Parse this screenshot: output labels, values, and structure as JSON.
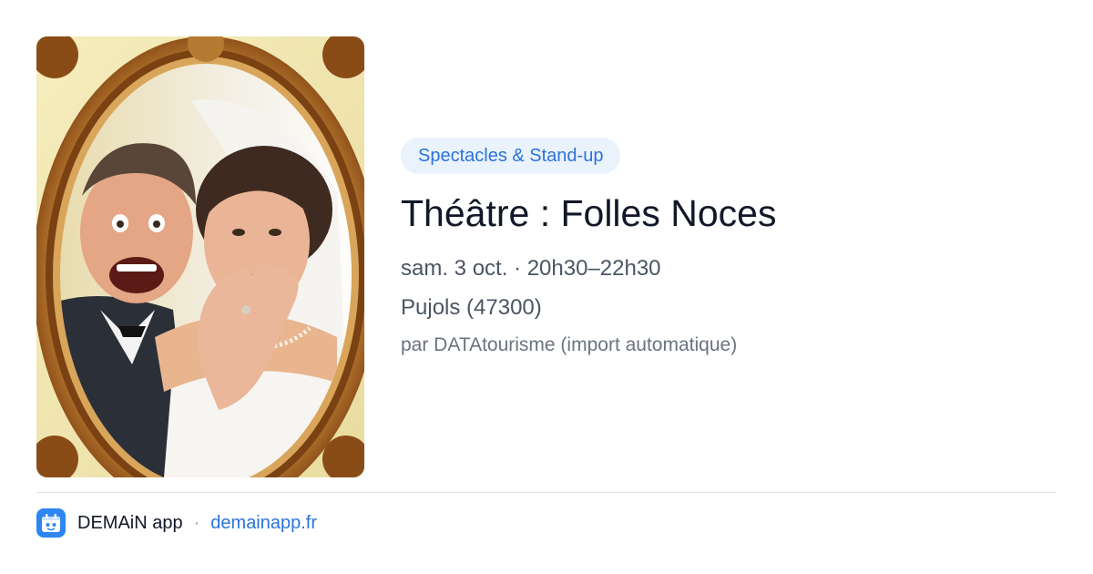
{
  "event": {
    "category": "Spectacles & Stand-up",
    "title": "Théâtre : Folles Noces",
    "datetime": "sam. 3 oct. · 20h30–22h30",
    "location": "Pujols (47300)",
    "source": "par DATAtourisme (import automatique)"
  },
  "footer": {
    "app_name": "DEMAiN app",
    "separator": "·",
    "url": "demainapp.fr"
  },
  "colors": {
    "accent": "#2b73d8",
    "chip_background": "#eaf2fc",
    "app_icon": "#2f86f0"
  }
}
